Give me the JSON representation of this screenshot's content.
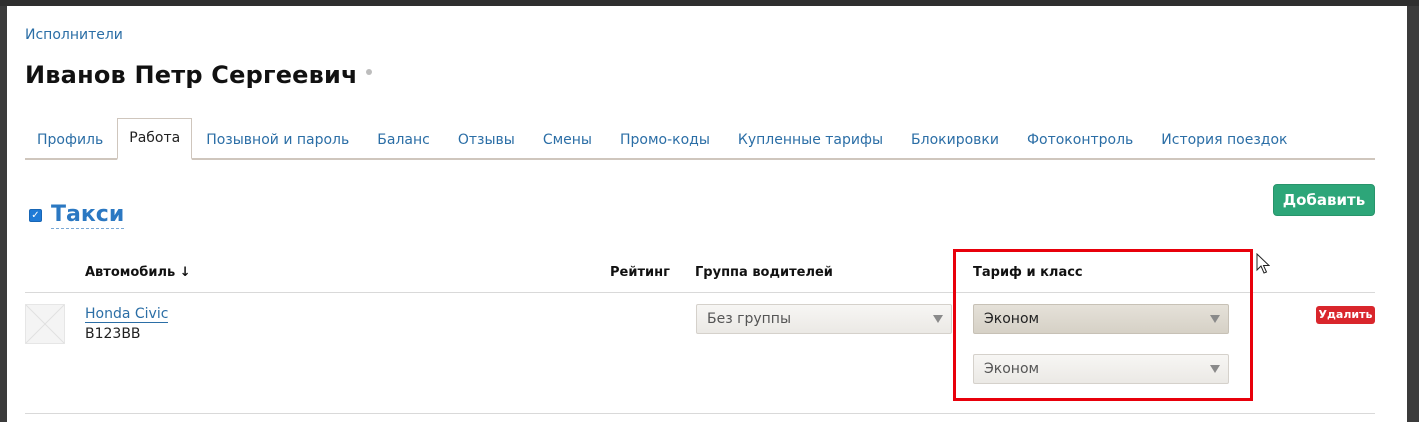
{
  "breadcrumb": "Исполнители",
  "page_title": "Иванов Петр Сергеевич",
  "tabs": [
    {
      "label": "Профиль",
      "active": false
    },
    {
      "label": "Работа",
      "active": true
    },
    {
      "label": "Позывной и пароль",
      "active": false
    },
    {
      "label": "Баланс",
      "active": false
    },
    {
      "label": "Отзывы",
      "active": false
    },
    {
      "label": "Смены",
      "active": false
    },
    {
      "label": "Промо-коды",
      "active": false
    },
    {
      "label": "Купленные тарифы",
      "active": false
    },
    {
      "label": "Блокировки",
      "active": false
    },
    {
      "label": "Фотоконтроль",
      "active": false
    },
    {
      "label": "История поездок",
      "active": false
    }
  ],
  "section": {
    "title": "Такси",
    "checked": true,
    "add_label": "Добавить"
  },
  "table": {
    "headers": {
      "car": "Автомобиль ↓",
      "rating": "Рейтинг",
      "group": "Группа водителей",
      "tariff": "Тариф и класс"
    },
    "rows": [
      {
        "car_name": "Honda Civic",
        "plate": "В123ВВ",
        "rating": "",
        "group": "Без группы",
        "tariff": "Эконом",
        "class": "Эконом",
        "delete_label": "Удалить"
      }
    ]
  },
  "colors": {
    "link": "#2b6ea6",
    "accent_green": "#2da679",
    "danger_red": "#d9262c",
    "highlight_red": "#e8000b"
  }
}
